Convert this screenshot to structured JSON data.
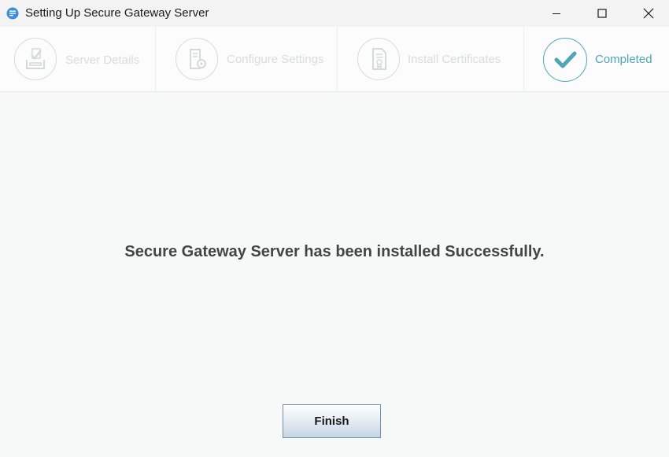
{
  "window": {
    "title": "Setting Up Secure Gateway Server",
    "app_icon": "app-icon",
    "controls": [
      "minimize-icon",
      "maximize-icon",
      "close-icon"
    ]
  },
  "steps": [
    {
      "label": "Server Details",
      "icon": "server-details-icon",
      "state": "inactive"
    },
    {
      "label": "Configure Settings",
      "icon": "configure-settings-icon",
      "state": "inactive"
    },
    {
      "label": "Install Certificates",
      "icon": "install-certificates-icon",
      "state": "inactive"
    },
    {
      "label": "Completed",
      "icon": "checkmark-icon",
      "state": "active"
    }
  ],
  "main": {
    "message": "Secure Gateway Server has been installed Successfully."
  },
  "footer": {
    "finish_label": "Finish"
  },
  "colors": {
    "accent": "#4ea6b8",
    "inactive": "#d9dcdc",
    "text": "#444444"
  }
}
